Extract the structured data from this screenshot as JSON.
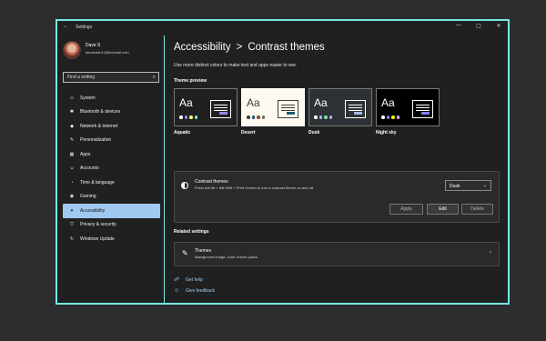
{
  "window": {
    "title": "Settings",
    "back_glyph": "←",
    "controls": [
      "—",
      "▢",
      "✕"
    ]
  },
  "user": {
    "name": "Dave S",
    "email": "sbhandari12@hotmail.com"
  },
  "search": {
    "placeholder": "Find a setting",
    "icon": "search-icon"
  },
  "sidebar": {
    "items": [
      {
        "label": "System",
        "icon": "▭"
      },
      {
        "label": "Bluetooth & devices",
        "icon": "✱"
      },
      {
        "label": "Network & internet",
        "icon": "◆"
      },
      {
        "label": "Personalization",
        "icon": "✎"
      },
      {
        "label": "Apps",
        "icon": "▦"
      },
      {
        "label": "Accounts",
        "icon": "☺"
      },
      {
        "label": "Time & language",
        "icon": "◔"
      },
      {
        "label": "Gaming",
        "icon": "◉"
      },
      {
        "label": "Accessibility",
        "icon": "✦"
      },
      {
        "label": "Privacy & security",
        "icon": "⛉"
      },
      {
        "label": "Windows Update",
        "icon": "↻"
      }
    ],
    "active_index": 8
  },
  "breadcrumb": {
    "parent": "Accessibility",
    "separator": ">",
    "current": "Contrast themes"
  },
  "subtitle": "Use more distinct colors to make text and apps easier to see.",
  "theme_preview": {
    "label": "Theme preview",
    "themes": [
      {
        "name": "Aquatic",
        "sample": "Aa",
        "bg": "#202020",
        "fg": "#ffffff",
        "dots": [
          "#ffffff",
          "#8a8af5",
          "#ffff66",
          "#75e8e2"
        ],
        "selected": false
      },
      {
        "name": "Desert",
        "sample": "Aa",
        "bg": "#fffaef",
        "fg": "#3d3d3d",
        "dots": [
          "#3d3d3d",
          "#1a5a6b",
          "#8b4a2b",
          "#6d6d6d"
        ],
        "selected": true
      },
      {
        "name": "Dusk",
        "sample": "Aa",
        "bg": "#2d3236",
        "fg": "#ffffff",
        "dots": [
          "#ffffff",
          "#a1bfde",
          "#7fd9a8",
          "#c6a1e5"
        ],
        "selected": false
      },
      {
        "name": "Night sky",
        "sample": "Aa",
        "bg": "#000000",
        "fg": "#ffffff",
        "dots": [
          "#ffffff",
          "#8080ff",
          "#ffff00",
          "#d6b4fc"
        ],
        "selected": false
      }
    ]
  },
  "contrast_panel": {
    "title": "Contrast themes",
    "description": "Press left Alt + left Shift + Print Screen to turn a contrast theme on and off",
    "dropdown_value": "Dusk",
    "buttons": {
      "apply": "Apply",
      "edit": "Edit",
      "delete": "Delete"
    }
  },
  "related": {
    "label": "Related settings",
    "themes_row": {
      "title": "Themes",
      "description": "Background image, color, theme packs"
    }
  },
  "links": {
    "get_help": "Get help",
    "give_feedback": "Give feedback"
  },
  "colors": {
    "accent_border": "#75e8e2",
    "active_nav": "#9fc9ee",
    "link": "#9fd0f5"
  }
}
